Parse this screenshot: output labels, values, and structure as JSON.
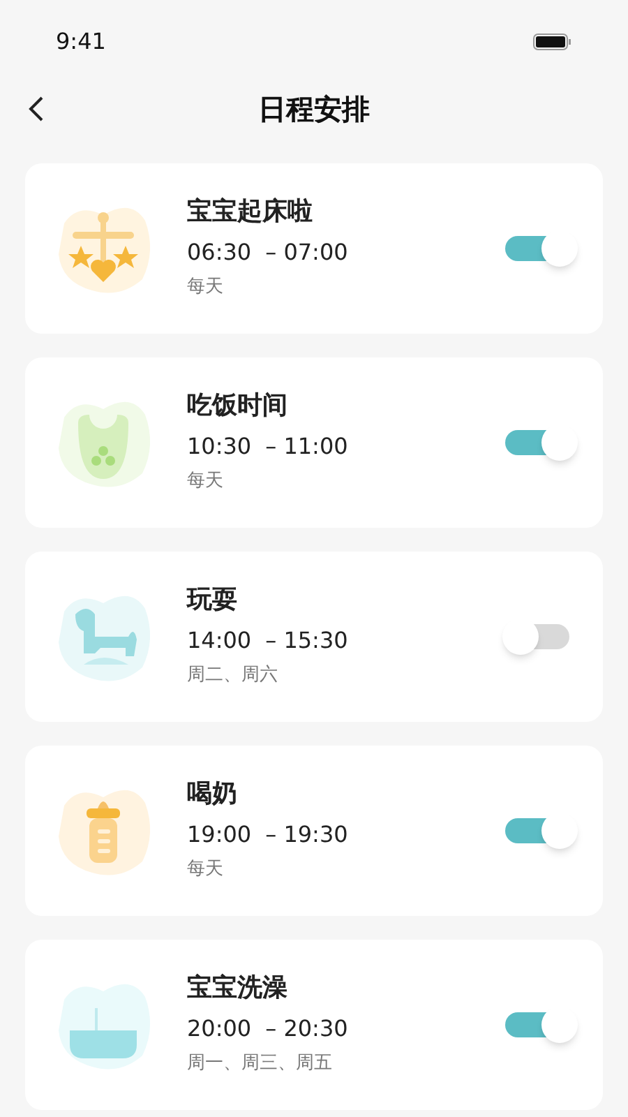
{
  "status_bar": {
    "time": "9:41"
  },
  "header": {
    "title": "日程安排"
  },
  "schedules": [
    {
      "kind": "mobile",
      "title": "宝宝起床啦",
      "start": "06:30",
      "end": "– 07:00",
      "days": "每天",
      "on": true
    },
    {
      "kind": "bib",
      "title": "吃饭时间",
      "start": "10:30",
      "end": "– 11:00",
      "days": "每天",
      "on": true
    },
    {
      "kind": "horse",
      "title": "玩耍",
      "start": "14:00",
      "end": "– 15:30",
      "days": "周二、周六",
      "on": false
    },
    {
      "kind": "bottle",
      "title": "喝奶",
      "start": "19:00",
      "end": "– 19:30",
      "days": "每天",
      "on": true
    },
    {
      "kind": "bathtub",
      "title": "宝宝洗澡",
      "start": "20:00",
      "end": "– 20:30",
      "days": "周一、周三、周五",
      "on": true
    }
  ]
}
